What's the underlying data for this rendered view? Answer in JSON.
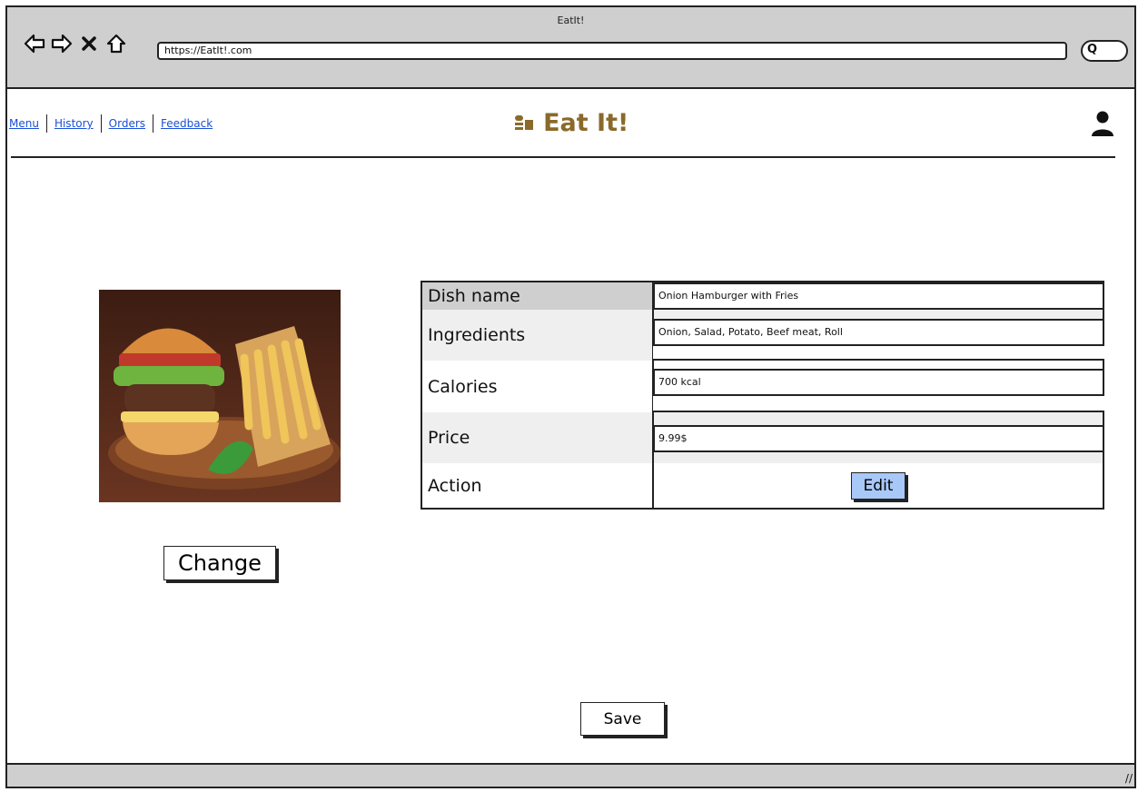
{
  "browser": {
    "window_title": "EatIt!",
    "url": "https://EatIt!.com"
  },
  "nav": {
    "items": [
      "Menu",
      "History",
      "Orders",
      "Feedback"
    ]
  },
  "brand": {
    "name": "Eat It!"
  },
  "dish": {
    "rows": [
      {
        "label": "Dish name",
        "value": "Onion Hamburger with Fries"
      },
      {
        "label": "Ingredients",
        "value": "Onion, Salad, Potato, Beef meat, Roll"
      },
      {
        "label": "Calories",
        "value": "700 kcal"
      },
      {
        "label": "Price",
        "value": "9.99$"
      },
      {
        "label": "Action"
      }
    ],
    "edit_label": "Edit"
  },
  "image_section": {
    "change_label": "Change"
  },
  "footer": {
    "save_label": "Save"
  },
  "colors": {
    "brand": "#8a6a2a",
    "link": "#1a4fd6",
    "edit_button": "#a8c8f8",
    "chrome": "#cfcfcf"
  }
}
